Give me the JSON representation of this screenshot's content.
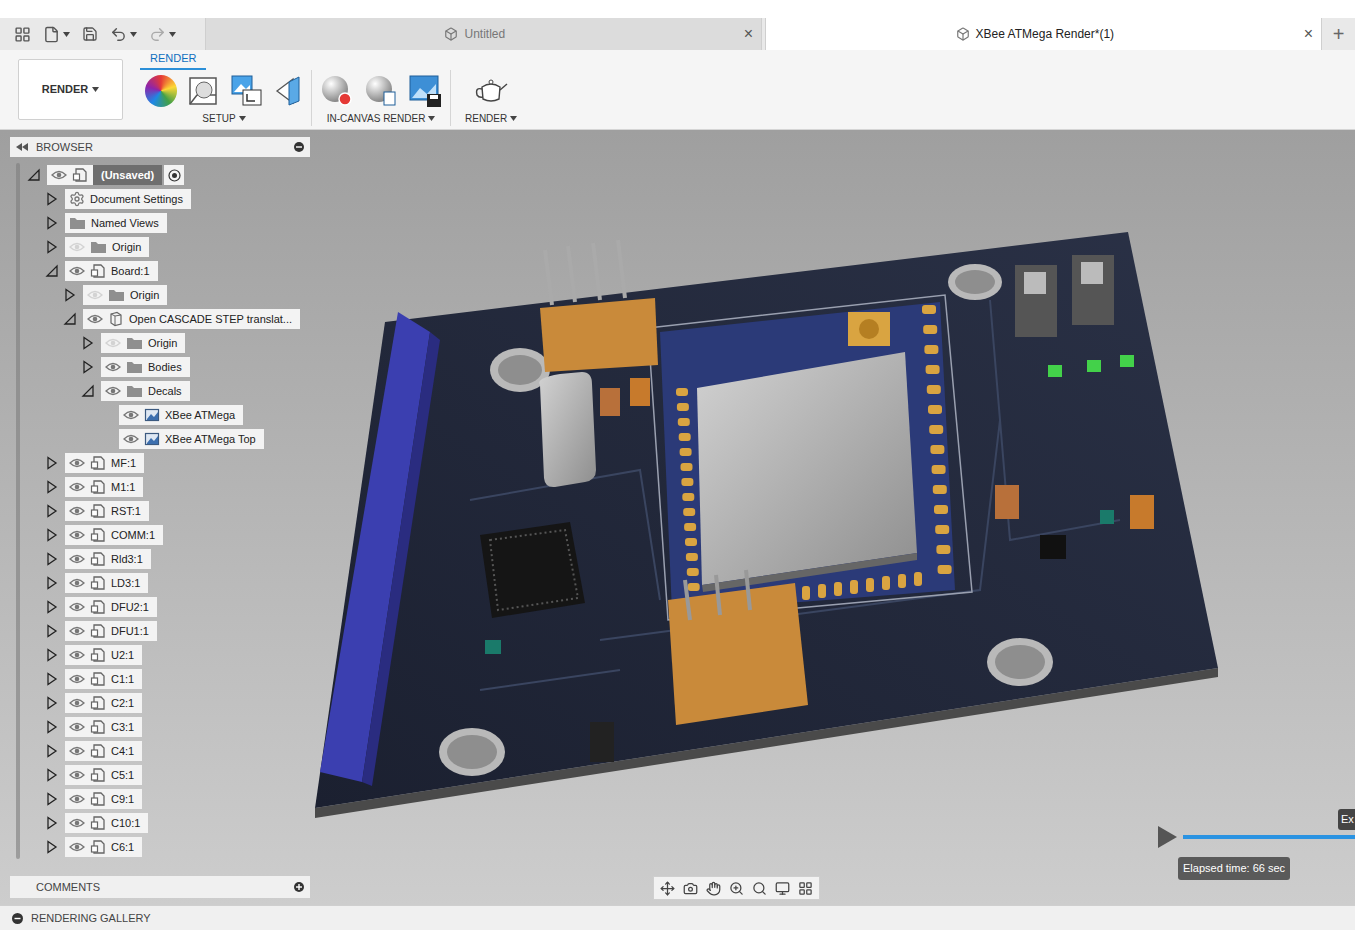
{
  "app_bar": {
    "new_tab": "+"
  },
  "tabs": [
    {
      "label": "Untitled",
      "close": "×",
      "selected": false
    },
    {
      "label": "XBee ATMega Render*(1)",
      "close": "×",
      "selected": true
    }
  ],
  "workspace": {
    "label": "RENDER"
  },
  "toolbar": {
    "tab": {
      "label": "RENDER",
      "selected": true
    },
    "groups": [
      {
        "label": "SETUP"
      },
      {
        "label": "IN-CANVAS RENDER"
      },
      {
        "label": "RENDER"
      }
    ]
  },
  "browser": {
    "title": "BROWSER",
    "items": [
      {
        "label": "(Unsaved)",
        "level": 0,
        "kind": "root",
        "expandable": true,
        "expanded": true,
        "has_eye": true,
        "visible": true,
        "selected": true
      },
      {
        "label": "Document Settings",
        "level": 1,
        "kind": "settings",
        "expandable": true,
        "expanded": false,
        "has_eye": false,
        "visible": true,
        "selected": false
      },
      {
        "label": "Named Views",
        "level": 1,
        "kind": "folder",
        "expandable": true,
        "expanded": false,
        "has_eye": false,
        "visible": true,
        "selected": false
      },
      {
        "label": "Origin",
        "level": 1,
        "kind": "folder",
        "expandable": true,
        "expanded": false,
        "has_eye": true,
        "visible": false,
        "selected": false
      },
      {
        "label": "Board:1",
        "level": 1,
        "kind": "component",
        "expandable": true,
        "expanded": true,
        "has_eye": true,
        "visible": true,
        "selected": false
      },
      {
        "label": "Origin",
        "level": 2,
        "kind": "folder",
        "expandable": true,
        "expanded": false,
        "has_eye": true,
        "visible": false,
        "selected": false
      },
      {
        "label": "Open CASCADE STEP translat...",
        "level": 2,
        "kind": "occurrence",
        "expandable": true,
        "expanded": true,
        "has_eye": true,
        "visible": true,
        "selected": false
      },
      {
        "label": "Origin",
        "level": 3,
        "kind": "folder",
        "expandable": true,
        "expanded": false,
        "has_eye": true,
        "visible": false,
        "selected": false
      },
      {
        "label": "Bodies",
        "level": 3,
        "kind": "folder",
        "expandable": true,
        "expanded": false,
        "has_eye": true,
        "visible": true,
        "selected": false
      },
      {
        "label": "Decals",
        "level": 3,
        "kind": "folder",
        "expandable": true,
        "expanded": true,
        "has_eye": true,
        "visible": true,
        "selected": false
      },
      {
        "label": "XBee ATMega",
        "level": 4,
        "kind": "decal",
        "expandable": false,
        "expanded": false,
        "has_eye": true,
        "visible": true,
        "selected": false
      },
      {
        "label": "XBee ATMega Top",
        "level": 4,
        "kind": "decal",
        "expandable": false,
        "expanded": false,
        "has_eye": true,
        "visible": true,
        "selected": false
      },
      {
        "label": "MF:1",
        "level": 1,
        "kind": "component",
        "expandable": true,
        "expanded": false,
        "has_eye": true,
        "visible": true,
        "selected": false
      },
      {
        "label": "M1:1",
        "level": 1,
        "kind": "component",
        "expandable": true,
        "expanded": false,
        "has_eye": true,
        "visible": true,
        "selected": false
      },
      {
        "label": "RST:1",
        "level": 1,
        "kind": "component",
        "expandable": true,
        "expanded": false,
        "has_eye": true,
        "visible": true,
        "selected": false
      },
      {
        "label": "COMM:1",
        "level": 1,
        "kind": "component",
        "expandable": true,
        "expanded": false,
        "has_eye": true,
        "visible": true,
        "selected": false
      },
      {
        "label": "Rld3:1",
        "level": 1,
        "kind": "component",
        "expandable": true,
        "expanded": false,
        "has_eye": true,
        "visible": true,
        "selected": false
      },
      {
        "label": "LD3:1",
        "level": 1,
        "kind": "component",
        "expandable": true,
        "expanded": false,
        "has_eye": true,
        "visible": true,
        "selected": false
      },
      {
        "label": "DFU2:1",
        "level": 1,
        "kind": "component",
        "expandable": true,
        "expanded": false,
        "has_eye": true,
        "visible": true,
        "selected": false
      },
      {
        "label": "DFU1:1",
        "level": 1,
        "kind": "component",
        "expandable": true,
        "expanded": false,
        "has_eye": true,
        "visible": true,
        "selected": false
      },
      {
        "label": "U2:1",
        "level": 1,
        "kind": "component",
        "expandable": true,
        "expanded": false,
        "has_eye": true,
        "visible": true,
        "selected": false
      },
      {
        "label": "C1:1",
        "level": 1,
        "kind": "component",
        "expandable": true,
        "expanded": false,
        "has_eye": true,
        "visible": true,
        "selected": false
      },
      {
        "label": "C2:1",
        "level": 1,
        "kind": "component",
        "expandable": true,
        "expanded": false,
        "has_eye": true,
        "visible": true,
        "selected": false
      },
      {
        "label": "C3:1",
        "level": 1,
        "kind": "component",
        "expandable": true,
        "expanded": false,
        "has_eye": true,
        "visible": true,
        "selected": false
      },
      {
        "label": "C4:1",
        "level": 1,
        "kind": "component",
        "expandable": true,
        "expanded": false,
        "has_eye": true,
        "visible": true,
        "selected": false
      },
      {
        "label": "C5:1",
        "level": 1,
        "kind": "component",
        "expandable": true,
        "expanded": false,
        "has_eye": true,
        "visible": true,
        "selected": false
      },
      {
        "label": "C9:1",
        "level": 1,
        "kind": "component",
        "expandable": true,
        "expanded": false,
        "has_eye": true,
        "visible": true,
        "selected": false
      },
      {
        "label": "C10:1",
        "level": 1,
        "kind": "component",
        "expandable": true,
        "expanded": false,
        "has_eye": true,
        "visible": true,
        "selected": false
      },
      {
        "label": "C6:1",
        "level": 1,
        "kind": "component",
        "expandable": true,
        "expanded": false,
        "has_eye": true,
        "visible": true,
        "selected": false
      }
    ]
  },
  "comments": {
    "title": "COMMENTS"
  },
  "gallery": {
    "title": "RENDERING GALLERY"
  },
  "render_progress": {
    "elapsed": "Elapsed time: 66 sec",
    "level": 1,
    "side_tab": "Ex"
  }
}
